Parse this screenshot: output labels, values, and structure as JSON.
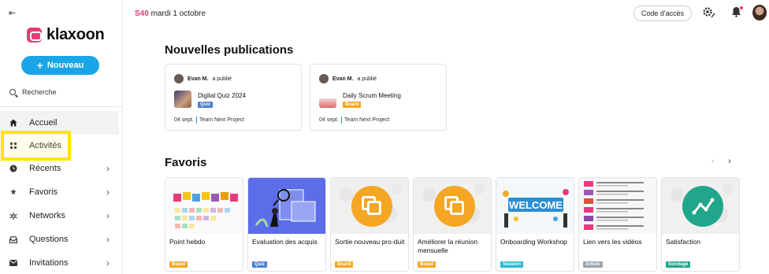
{
  "sidebar": {
    "collapse_icon": "collapse-sidebar-icon",
    "logo_text": "klaxoon",
    "new_button": "Nouveau",
    "search_label": "Recherche",
    "items": [
      {
        "label": "Accueil",
        "icon": "home-icon",
        "chevron": false,
        "active": true
      },
      {
        "label": "Activités",
        "icon": "activities-icon",
        "chevron": false,
        "active": false
      },
      {
        "label": "Récents",
        "icon": "clock-icon",
        "chevron": true,
        "active": false
      },
      {
        "label": "Favoris",
        "icon": "star-icon",
        "chevron": true,
        "active": false
      },
      {
        "label": "Networks",
        "icon": "networks-icon",
        "chevron": true,
        "active": false
      },
      {
        "label": "Questions",
        "icon": "inbox-icon",
        "chevron": true,
        "active": false
      },
      {
        "label": "Invitations",
        "icon": "mail-icon",
        "chevron": true,
        "active": false
      }
    ]
  },
  "header": {
    "week": "S40",
    "date": "mardi 1 octobre",
    "code_button": "Code d'accès"
  },
  "publications": {
    "title": "Nouvelles publications",
    "items": [
      {
        "author": "Evan M.",
        "action": "a publié",
        "title": "Digital Quiz 2024",
        "tag": "Quiz",
        "tag_color": "#4a7fd4",
        "date": "04 sept.",
        "team": "Team Next Project"
      },
      {
        "author": "Evan M.",
        "action": "a publié",
        "title": "Daily Scrum Meeting",
        "tag": "Board",
        "tag_color": "#f5a623",
        "date": "04 sept.",
        "team": "Team Next Project"
      }
    ]
  },
  "favoris": {
    "title": "Favoris",
    "prev": "‹",
    "next": "›",
    "items": [
      {
        "title": "Point hebdo",
        "tag": "Board",
        "tag_color": "#f5a623"
      },
      {
        "title": "Evaluation des acquis",
        "tag": "Quiz",
        "tag_color": "#4a7fd4"
      },
      {
        "title": "Sortie nouveau pro-duit",
        "tag": "Board",
        "tag_color": "#f5a623"
      },
      {
        "title": "Améliorer la réunion mensuelle",
        "tag": "Board",
        "tag_color": "#f5a623"
      },
      {
        "title": "Onboarding Workshop",
        "tag": "Session",
        "tag_color": "#29b6d6"
      },
      {
        "title": "Lien vers les vidéos",
        "tag": "Article",
        "tag_color": "#9aa3ad"
      },
      {
        "title": "Satisfaction",
        "tag": "Sondage",
        "tag_color": "#20a68b"
      }
    ]
  }
}
